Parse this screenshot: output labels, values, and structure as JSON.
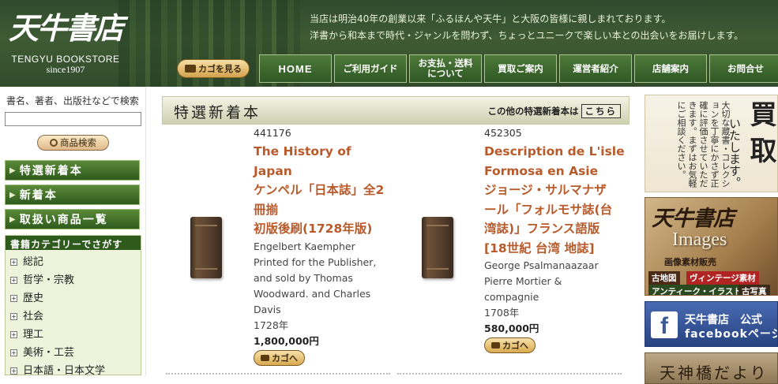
{
  "header": {
    "logo_main": "天牛書店",
    "logo_sub": "TENGYU BOOKSTORE",
    "logo_since": "since1907",
    "tagline_1": "当店は明治40年の創業以来「ふるほんや天牛」と大阪の皆様に親しまれております。",
    "tagline_2": "洋書から和本まで時代・ジャンルを問わず、ちょっとユニークで楽しい本との出会いをお届けします。",
    "cart_button": "カゴを見る"
  },
  "nav": {
    "items": [
      {
        "label": "HOME"
      },
      {
        "label": "ご利用ガイド"
      },
      {
        "label": "お支払・送料\nについて"
      },
      {
        "label": "買取ご案内"
      },
      {
        "label": "運営者紹介"
      },
      {
        "label": "店舗案内"
      },
      {
        "label": "お問合せ"
      }
    ]
  },
  "sidebar": {
    "search_label": "書名、著者、出版社などで検索",
    "search_value": "",
    "search_button": "商品検索",
    "menu": [
      {
        "label": "特選新着本"
      },
      {
        "label": "新着本"
      },
      {
        "label": "取扱い商品一覧"
      }
    ],
    "category_heading": "書籍カテゴリーでさがす",
    "categories": [
      "総記",
      "哲学・宗教",
      "歴史",
      "社会",
      "理工",
      "美術・工芸",
      "日本語・日本文学"
    ]
  },
  "main": {
    "section_title": "特選新着本",
    "section_more": "この他の特選新着本は",
    "section_more_link": "こちら",
    "products": [
      {
        "id": "441176",
        "title_lines": [
          "The History of",
          "Japan",
          "ケンペル「日本誌」全2",
          "冊揃",
          "初版後刷(1728年版)"
        ],
        "meta_lines": [
          "Engelbert Kaempher",
          "Printed for the Publisher,",
          "and sold by Thomas",
          "Woodward. and Charles",
          "Davis",
          "1728年"
        ],
        "price": "1,800,000円",
        "cart_label": "カゴへ"
      },
      {
        "id": "452305",
        "title_lines": [
          "Description de L'isle",
          "Formosa en Asie",
          "ジョージ・サルマナザ",
          "ール「フォルモサ誌(台",
          "湾誌)」フランス語版",
          "[18世紀 台湾 地誌]"
        ],
        "meta_lines": [
          "George Psalmanaazaar",
          "Pierre Mortier &",
          "compagnie",
          "1708年"
        ],
        "price": "580,000円",
        "cart_label": "カゴへ"
      }
    ]
  },
  "banners": {
    "kaitori": {
      "vertical_text": "大切な蔵書・コレクションを丁寧にかさず正確に評価させていただきます。まずはお気軽にご相談ください。",
      "big_1": "買",
      "big_2": "取",
      "mid": "いたします。"
    },
    "images": {
      "logo": "天牛書店",
      "title": "Images",
      "subtitle": "画像素材販売",
      "tags": [
        "古地図",
        "ヴィンテージ素材",
        "アンティーク・イラスト",
        "古写真"
      ]
    },
    "facebook": {
      "icon_letter": "f",
      "line1": "天牛書店　公式",
      "line2": "facebookページ"
    },
    "tenjin": {
      "text": "天神橋だより"
    }
  }
}
